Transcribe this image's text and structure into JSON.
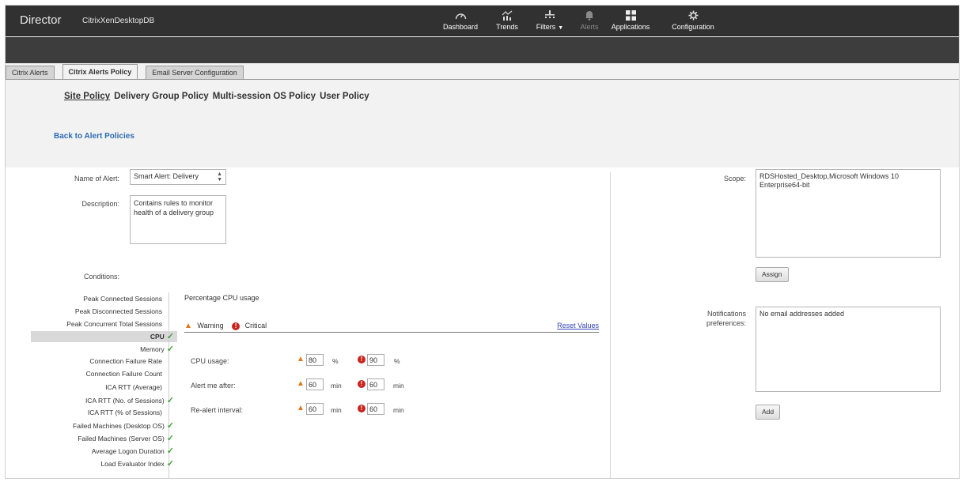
{
  "header": {
    "brand": "Director",
    "site": "CitrixXenDesktopDB",
    "nav": [
      {
        "label": "Dashboard",
        "icon": "gauge-icon"
      },
      {
        "label": "Trends",
        "icon": "trends-icon"
      },
      {
        "label": "Filters",
        "icon": "filters-icon"
      },
      {
        "label": "Alerts",
        "icon": "bell-icon"
      },
      {
        "label": "Applications",
        "icon": "grid-icon"
      },
      {
        "label": "Configuration",
        "icon": "gear-icon"
      }
    ]
  },
  "tabs": [
    "Citrix Alerts",
    "Citrix Alerts Policy",
    "Email Server Configuration"
  ],
  "policies": [
    "Site Policy",
    "Delivery Group Policy",
    "Multi-session OS Policy",
    "User Policy"
  ],
  "back_link": "Back to Alert Policies",
  "form": {
    "name_label": "Name of Alert:",
    "name_value": "Smart Alert: Delivery",
    "description_label": "Description:",
    "description_value": "Contains rules to monitor health of a delivery group",
    "conditions_label": "Conditions:",
    "scope_label": "Scope:",
    "scope_value": "RDSHosted_Desktop,Microsoft Windows 10 Enterprise64-bit",
    "assign_button": "Assign",
    "notifications_label_1": "Notifications",
    "notifications_label_2": "preferences:",
    "notifications_value": "No email addresses added",
    "add_button": "Add"
  },
  "conditions": [
    {
      "label": "Peak Connected Sessions",
      "checked": false
    },
    {
      "label": "Peak Disconnected Sessions",
      "checked": false
    },
    {
      "label": "Peak Concurrent Total Sessions",
      "checked": false
    },
    {
      "label": "CPU",
      "checked": true,
      "selected": true
    },
    {
      "label": "Memory",
      "checked": true
    },
    {
      "label": "Connection Failure Rate",
      "checked": false
    },
    {
      "label": "Connection Failure Count",
      "checked": false
    },
    {
      "label": "ICA RTT (Average)",
      "checked": false
    },
    {
      "label": "ICA RTT (No. of Sessions)",
      "checked": true
    },
    {
      "label": "ICA RTT (% of Sessions)",
      "checked": false
    },
    {
      "label": "Failed Machines (Desktop OS)",
      "checked": true
    },
    {
      "label": "Failed Machines (Server OS)",
      "checked": true
    },
    {
      "label": "Average Logon Duration",
      "checked": true
    },
    {
      "label": "Load Evaluator Index",
      "checked": true
    }
  ],
  "detail": {
    "title": "Percentage CPU usage",
    "warning_label": "Warning",
    "critical_label": "Critical",
    "reset_link": "Reset Values",
    "rows": [
      {
        "label": "CPU usage:",
        "warning": "80",
        "warning_unit": "%",
        "critical": "90",
        "critical_unit": "%"
      },
      {
        "label": "Alert me after:",
        "warning": "60",
        "warning_unit": "min",
        "critical": "60",
        "critical_unit": "min"
      },
      {
        "label": "Re-alert interval:",
        "warning": "60",
        "warning_unit": "min",
        "critical": "60",
        "critical_unit": "min"
      }
    ]
  },
  "colors": {
    "topbar": "#313131",
    "link": "#2d6cb4",
    "check": "#46a33b",
    "warning": "#e0781b",
    "critical": "#c8241e"
  }
}
